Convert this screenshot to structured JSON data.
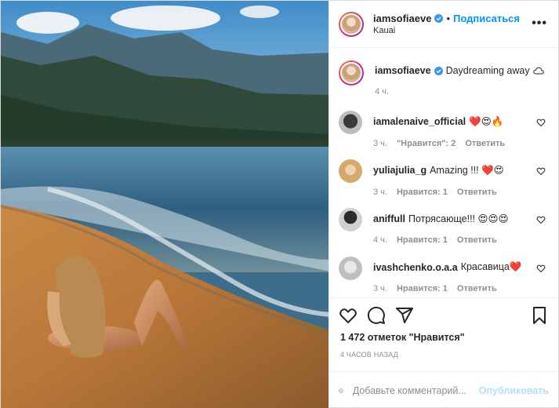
{
  "header": {
    "username": "iamsofiaeve",
    "separator": "•",
    "follow_label": "Подписаться",
    "location": "Kauai",
    "more_label": "•••"
  },
  "caption": {
    "username": "iamsofiaeve",
    "text": "Daydreaming away",
    "emoji_icon": "cloud-icon",
    "time": "4 ч."
  },
  "comments": [
    {
      "username": "iamalenaive_official",
      "text": "❤️😍🔥",
      "time": "3 ч.",
      "likes": "\"Нравится\": 2",
      "reply": "Ответить"
    },
    {
      "username": "yuliajulia_g",
      "text": "Amazing !!! ❤️😍",
      "time": "3 ч.",
      "likes": "Нравится: 1",
      "reply": "Ответить"
    },
    {
      "username": "aniffull",
      "text": "Потрясающе!!! 😍😍😍",
      "time": "4 ч.",
      "likes": "Нравится: 1",
      "reply": "Ответить"
    },
    {
      "username": "ivashchenko.o.a.a",
      "text": "Красавица❤️",
      "time": "3 ч.",
      "likes": "Нравится: 1",
      "reply": "Ответить"
    }
  ],
  "likes_text": "1 472 отметок \"Нравится\"",
  "posted_time": "4 ЧАСОВ НАЗАД",
  "add_comment": {
    "placeholder": "Добавьте комментарий...",
    "publish_label": "Опубликовать"
  },
  "colors": {
    "link_blue": "#0095f6",
    "publish_disabled": "#b2dffc",
    "muted": "#8e8e8e",
    "verified": "#3897f0"
  }
}
